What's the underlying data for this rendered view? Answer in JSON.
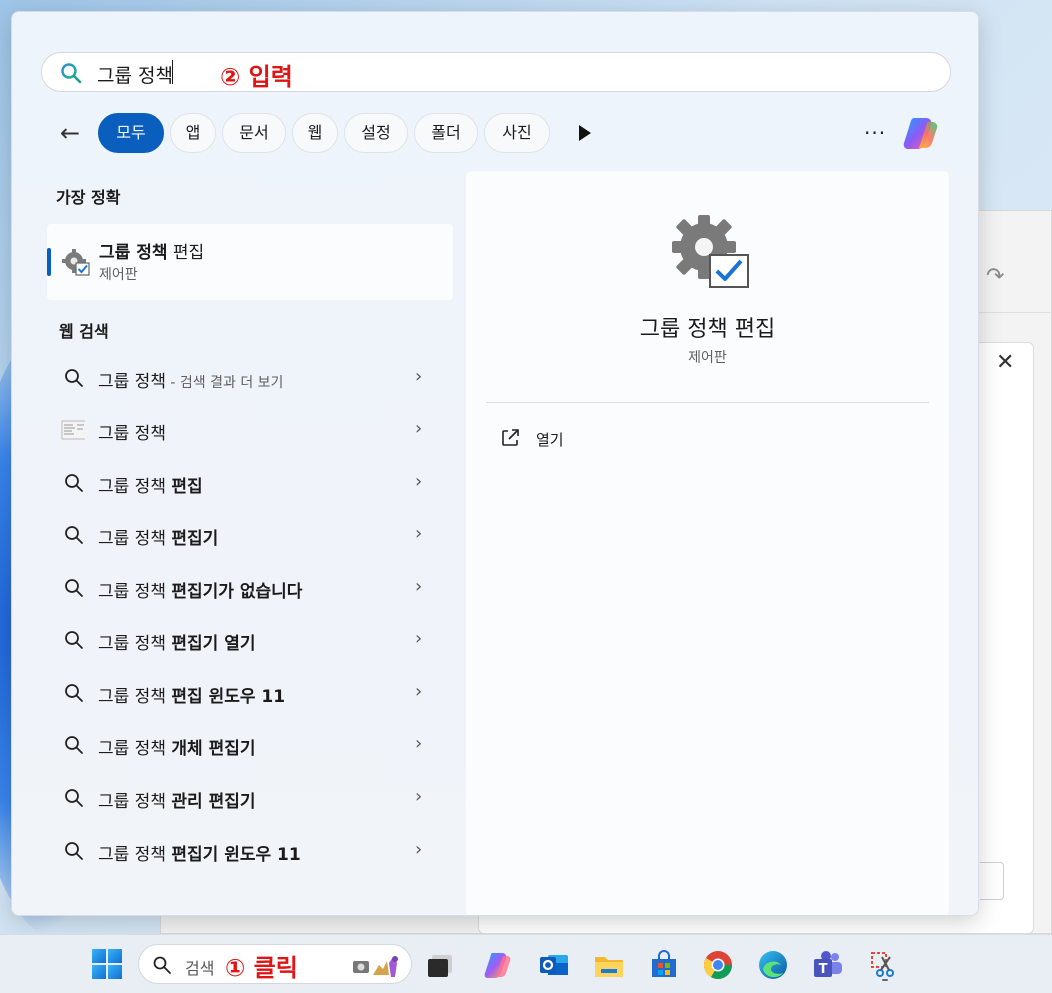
{
  "search": {
    "query": "그룹 정책",
    "annotation": "② 입력"
  },
  "filters": [
    {
      "label": "모두",
      "active": true
    },
    {
      "label": "앱"
    },
    {
      "label": "문서"
    },
    {
      "label": "웹"
    },
    {
      "label": "설정"
    },
    {
      "label": "폴더"
    },
    {
      "label": "사진"
    }
  ],
  "best_match": {
    "section": "가장 정확",
    "title_bold": "그룹 정책",
    "title_rest": " 편집",
    "subtitle": "제어판"
  },
  "web": {
    "section": "웹 검색",
    "items": [
      {
        "prefix": "그룹 정책",
        "bold": "",
        "sub": " - 검색 결과 더 보기",
        "icon": "search-icon"
      },
      {
        "prefix": "그룹 정책",
        "bold": "",
        "sub": "",
        "icon": "document-thumbnail-icon"
      },
      {
        "prefix": "그룹 정책 ",
        "bold": "편집",
        "sub": "",
        "icon": "search-icon"
      },
      {
        "prefix": "그룹 정책 ",
        "bold": "편집기",
        "sub": "",
        "icon": "search-icon"
      },
      {
        "prefix": "그룹 정책 ",
        "bold": "편집기가 없습니다",
        "sub": "",
        "icon": "search-icon"
      },
      {
        "prefix": "그룹 정책 ",
        "bold": "편집기 열기",
        "sub": "",
        "icon": "search-icon"
      },
      {
        "prefix": "그룹 정책 ",
        "bold": "편집 윈도우 11",
        "sub": "",
        "icon": "search-icon"
      },
      {
        "prefix": "그룹 정책 ",
        "bold": "개체 편집기",
        "sub": "",
        "icon": "search-icon"
      },
      {
        "prefix": "그룹 정책 ",
        "bold": "관리 편집기",
        "sub": "",
        "icon": "search-icon"
      },
      {
        "prefix": "그룹 정책 ",
        "bold": "편집기 윈도우 11",
        "sub": "",
        "icon": "search-icon"
      }
    ]
  },
  "detail": {
    "title": "그룹 정책 편집",
    "subtitle": "제어판",
    "open_label": "열기"
  },
  "taskbar": {
    "search_label": "검색",
    "annotation": "① 클릭",
    "apps": [
      "task-view-icon",
      "copilot-icon",
      "outlook-icon",
      "file-explorer-icon",
      "microsoft-store-icon",
      "chrome-icon",
      "edge-icon",
      "teams-icon",
      "snipping-tool-icon"
    ]
  },
  "colors": {
    "accent": "#0a5ebd",
    "annotation": "#e11414"
  }
}
